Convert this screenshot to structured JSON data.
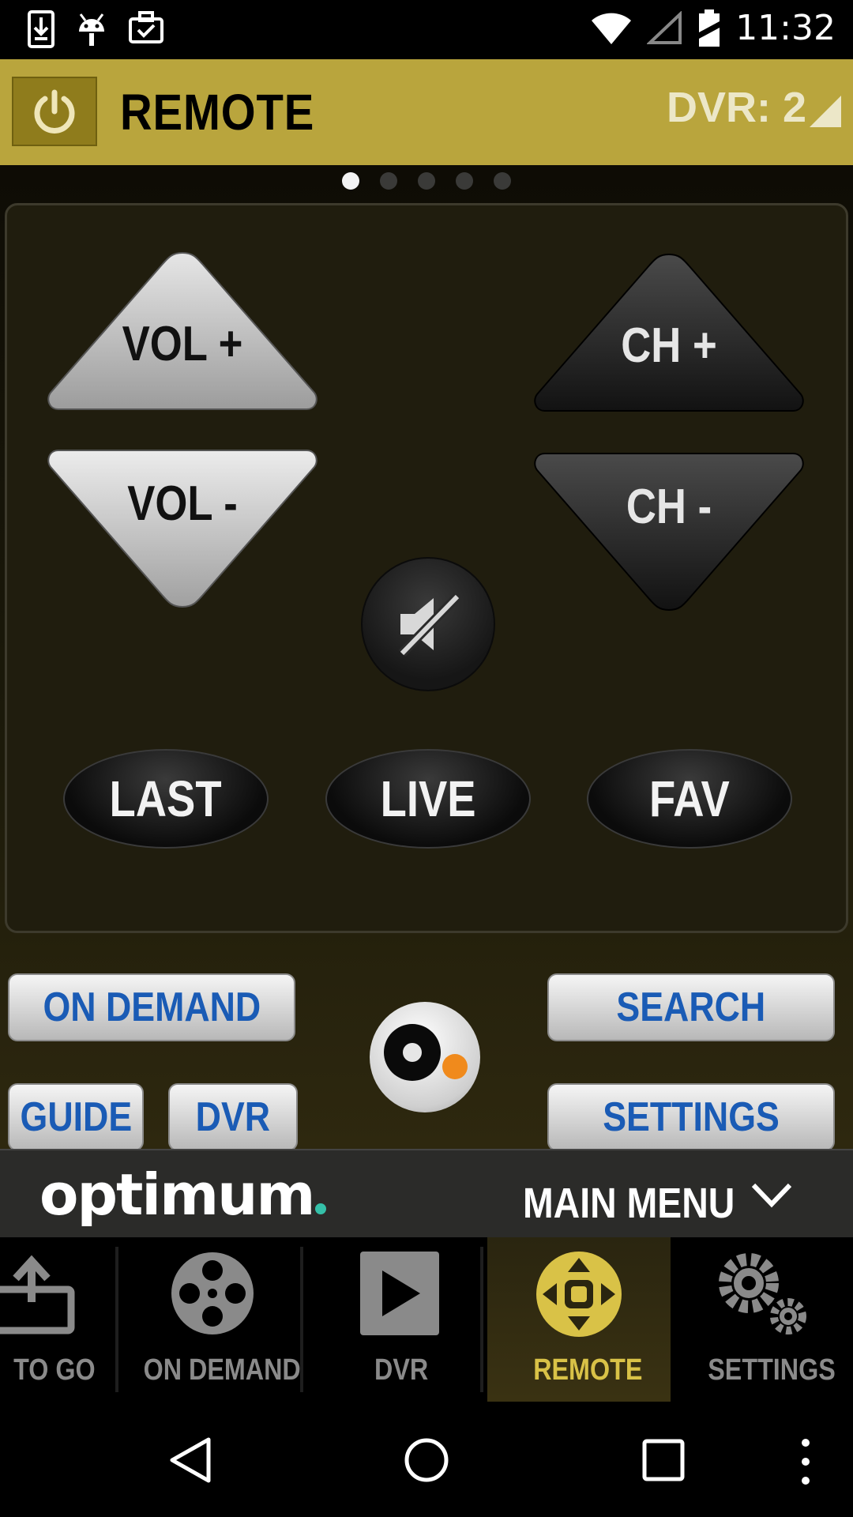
{
  "status_bar": {
    "time": "11:32",
    "icons": [
      "download-icon",
      "android-icon",
      "clipboard-check-icon",
      "wifi-icon",
      "cell-signal-icon",
      "battery-icon"
    ]
  },
  "header": {
    "title": "REMOTE",
    "dvr_selector": "DVR: 2",
    "accent_color": "#b9a53d"
  },
  "pager": {
    "pages": 5,
    "active": 0
  },
  "remote": {
    "vol_up": "VOL +",
    "vol_down": "VOL -",
    "ch_up": "CH +",
    "ch_down": "CH -",
    "mute_icon": "speaker-muted-icon",
    "last": "LAST",
    "live": "LIVE",
    "fav": "FAV"
  },
  "shortcuts": {
    "on_demand": "ON DEMAND",
    "search": "SEARCH",
    "guide": "GUIDE",
    "dvr": "DVR",
    "settings": "SETTINGS"
  },
  "menu_bar": {
    "brand": "optimum",
    "main_menu": "MAIN MENU"
  },
  "bottom_nav": {
    "items": [
      {
        "label": "TO GO",
        "icon": "upload-tv-icon"
      },
      {
        "label": "ON DEMAND",
        "icon": "film-reel-icon"
      },
      {
        "label": "DVR",
        "icon": "play-icon"
      },
      {
        "label": "REMOTE",
        "icon": "dpad-icon"
      },
      {
        "label": "SETTINGS",
        "icon": "gears-icon"
      }
    ],
    "active": "REMOTE"
  }
}
